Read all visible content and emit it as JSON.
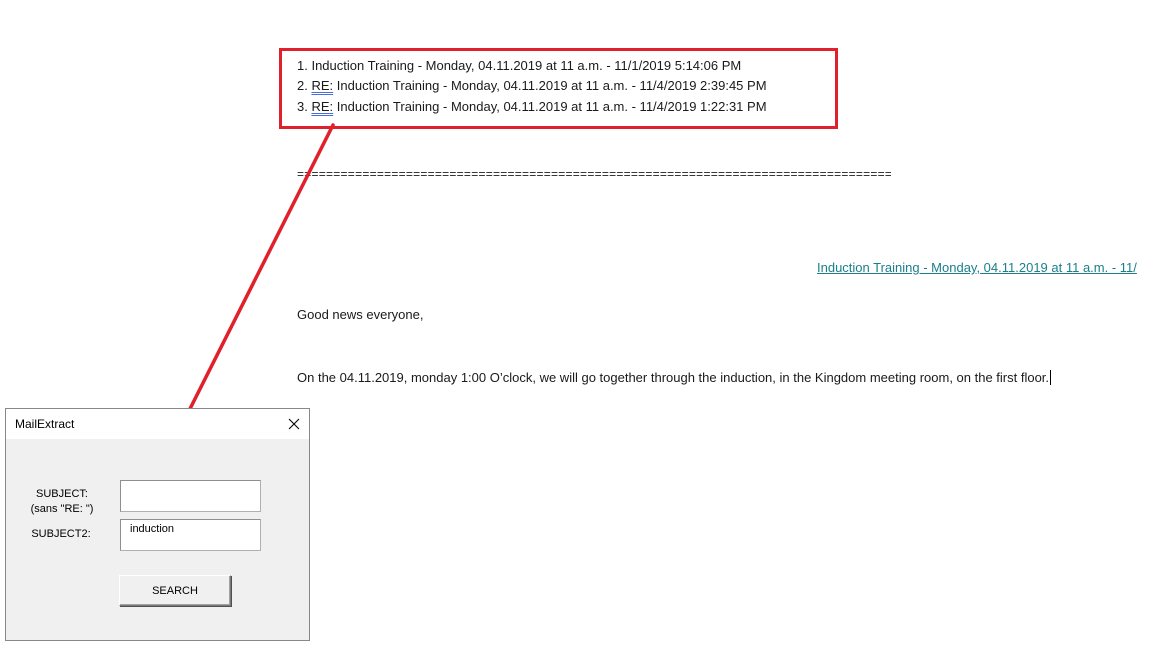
{
  "document": {
    "results": [
      {
        "num": "1.",
        "prefix": "",
        "subject": "Induction Training - Monday, 04.11.2019 at 11 a.m. - 11/1/2019 5:14:06 PM"
      },
      {
        "num": "2.",
        "prefix": "RE:",
        "subject": "Induction Training - Monday, 04.11.2019 at 11 a.m. - 11/4/2019 2:39:45 PM"
      },
      {
        "num": "3.",
        "prefix": "RE:",
        "subject": "Induction Training - Monday, 04.11.2019 at 11 a.m. - 11/4/2019 1:22:31 PM"
      }
    ],
    "separator": "=======================================================================================",
    "mail_link": "Induction Training - Monday, 04.11.2019 at 11 a.m. - 11/",
    "greeting": "Good news everyone,",
    "body": "On the 04.11.2019, monday 1:00 O’clock, we will go together through the induction, in the Kingdom meeting room, on the first floor."
  },
  "dialog": {
    "title": "MailExtract",
    "subject_label": "SUBJECT:",
    "subject_sublabel": "(sans \"RE: \")",
    "subject_value": "",
    "subject2_label": "SUBJECT2:",
    "subject2_value": "induction",
    "search_label": "SEARCH"
  },
  "annotation": {
    "color": "#e0202a"
  }
}
